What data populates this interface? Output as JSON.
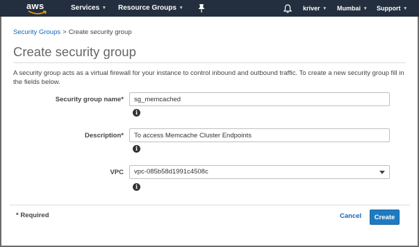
{
  "topnav": {
    "logo_text": "aws",
    "services_label": "Services",
    "resource_groups_label": "Resource Groups",
    "user_label": "kriver",
    "region_label": "Mumbai",
    "support_label": "Support",
    "pin_icon": "pin-icon",
    "bell_icon": "bell-icon",
    "caret_icon": "▾"
  },
  "breadcrumb": {
    "parent": "Security Groups",
    "separator": ">",
    "current": "Create security group"
  },
  "dialog": {
    "title": "Create security group",
    "description": "A security group acts as a virtual firewall for your instance to control inbound and outbound traffic. To create a new security group fill in the fields below.",
    "fields": {
      "name": {
        "label": "Security group name*",
        "value": "sg_memcached"
      },
      "description": {
        "label": "Description*",
        "value": "To access Memcache Cluster Endpoints"
      },
      "vpc": {
        "label": "VPC",
        "value": "vpc-085b58d1991c4508c"
      }
    },
    "info_glyph": "i",
    "required_note": "* Required",
    "cancel_label": "Cancel",
    "create_label": "Create"
  },
  "colors": {
    "nav_bg": "#232f3e",
    "link": "#1166bb",
    "primary_button": "#1f7bc1"
  }
}
